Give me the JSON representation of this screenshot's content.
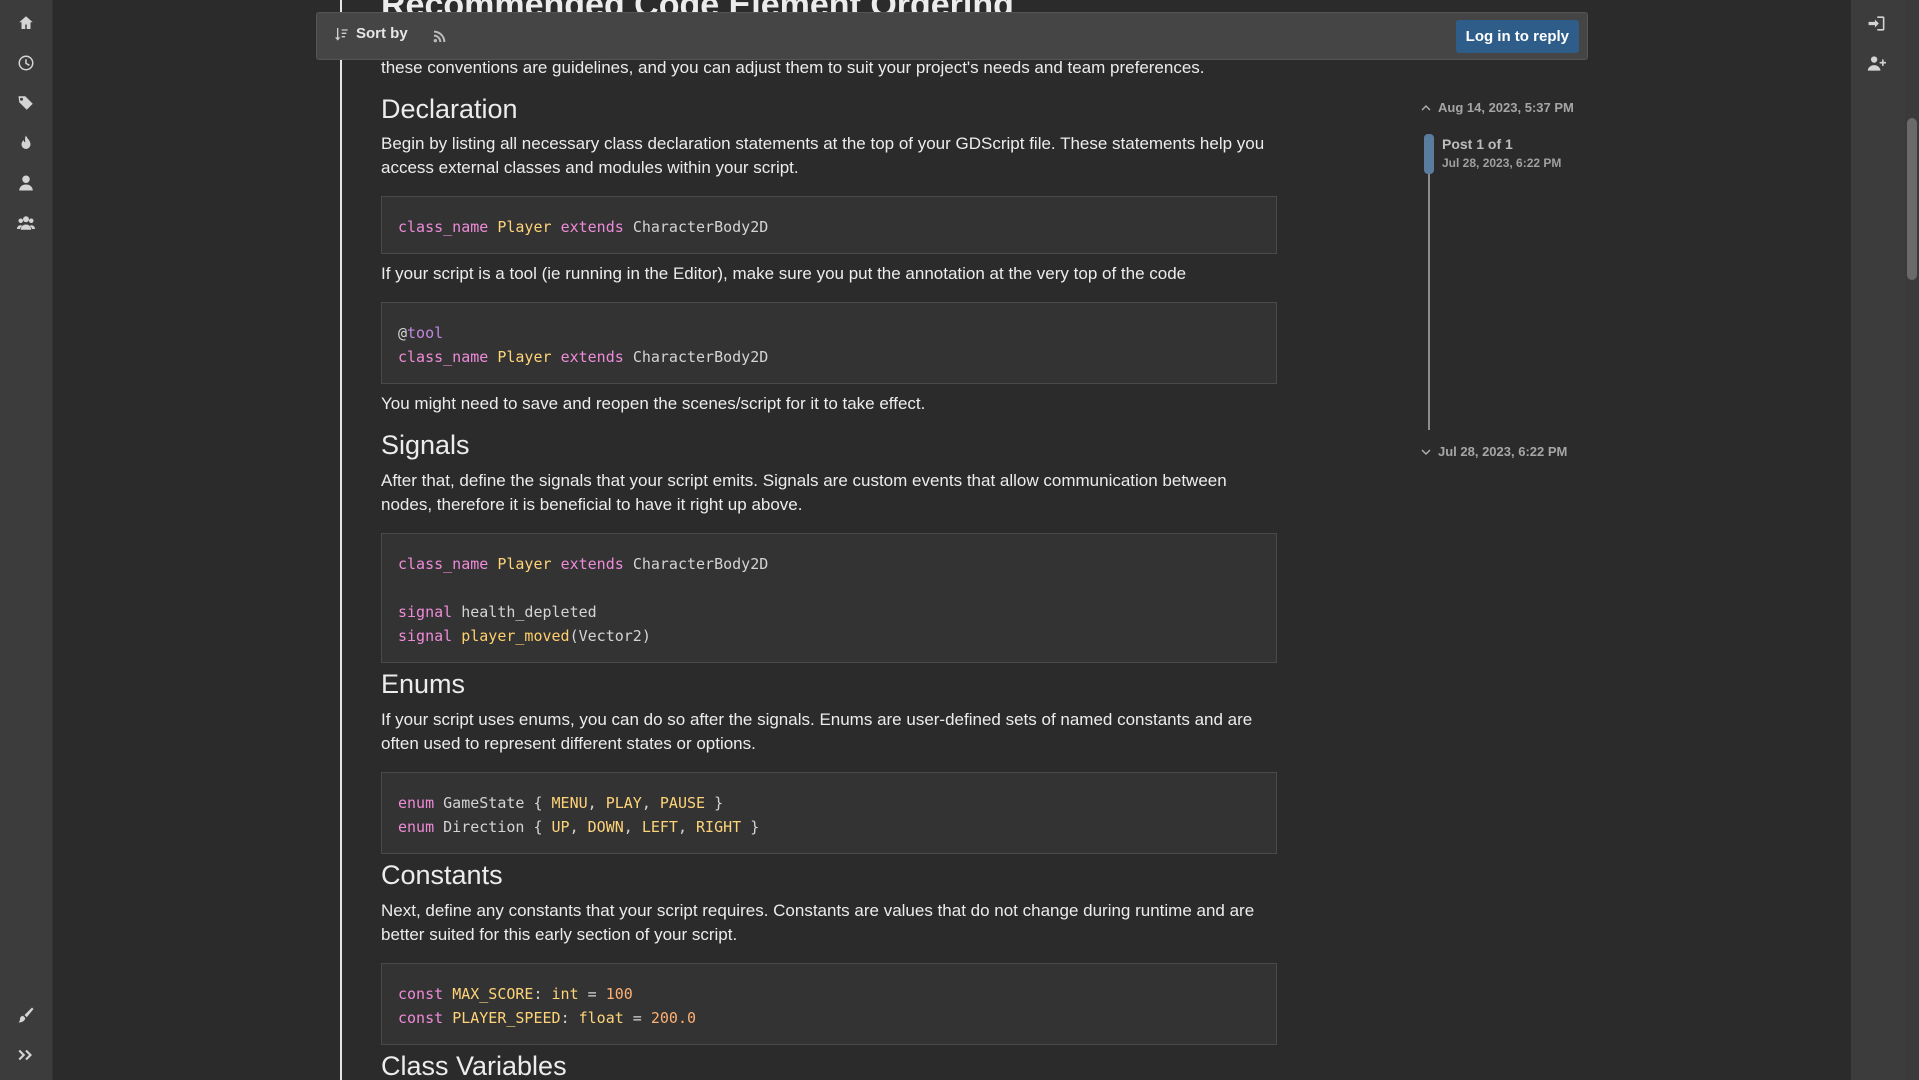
{
  "page": {
    "title": "Recommended Code Element Ordering",
    "intro": "these conventions are guidelines, and you can adjust them to suit your project's needs and team preferences."
  },
  "toolbar": {
    "sort_label": "Sort by",
    "login_label": "Log in to reply"
  },
  "timeline": {
    "top_date": "Aug 14, 2023, 5:37 PM",
    "post_label": "Post 1 of 1",
    "post_date": "Jul 28, 2023, 6:22 PM",
    "bottom_date": "Jul 28, 2023, 6:22 PM"
  },
  "sections": {
    "declaration": {
      "heading": "Declaration",
      "text": "Begin by listing all necessary class declaration statements at the top of your GDScript file. These statements help you access external classes and modules within your script.",
      "tool_text": "If your script is a tool (ie running in the Editor), make sure you put the annotation at the very top of the code",
      "after_text": "You might need to save and reopen the scenes/script for it to take effect."
    },
    "signals": {
      "heading": "Signals",
      "text": "After that, define the signals that your script emits. Signals are custom events that allow communication between nodes, therefore it is beneficial to have it right up above."
    },
    "enums": {
      "heading": "Enums",
      "text": "If your script uses enums, you can do so after the signals. Enums are user-defined sets of named constants and are often used to represent different states or options."
    },
    "constants": {
      "heading": "Constants",
      "text": "Next, define any constants that your script requires. Constants are values that do not change during runtime and are better suited for this early section of your script."
    },
    "class_variables": {
      "heading": "Class Variables"
    }
  },
  "code": {
    "kw_class_name": "class_name",
    "kw_extends": "extends",
    "kw_signal": "signal",
    "kw_enum": "enum",
    "kw_const": "const",
    "player": "Player",
    "base": "CharacterBody2D",
    "at": "@",
    "tool": "tool",
    "health_depleted": "health_depleted",
    "player_moved": "player_moved",
    "vector2_args": "(Vector2)",
    "gamestate": "GameState",
    "direction": "Direction",
    "menu": "MENU",
    "play": "PLAY",
    "pause": "PAUSE",
    "up": "UP",
    "down": "DOWN",
    "left": "LEFT",
    "right": "RIGHT",
    "max_score": "MAX_SCORE",
    "player_speed": "PLAYER_SPEED",
    "int": "int",
    "float": "float",
    "v100": "100",
    "v200": "200.0"
  },
  "icons": {
    "left": [
      "home-icon",
      "clock-icon",
      "tags-icon",
      "fire-icon",
      "user-icon",
      "users-icon",
      "brush-icon",
      "expand-icon"
    ],
    "right": [
      "sign-in-icon",
      "user-plus-icon"
    ]
  },
  "colors": {
    "accent": "#2e5d8a",
    "keyword": "#ee8bd8",
    "type": "#ffd479",
    "number": "#ffb073"
  }
}
